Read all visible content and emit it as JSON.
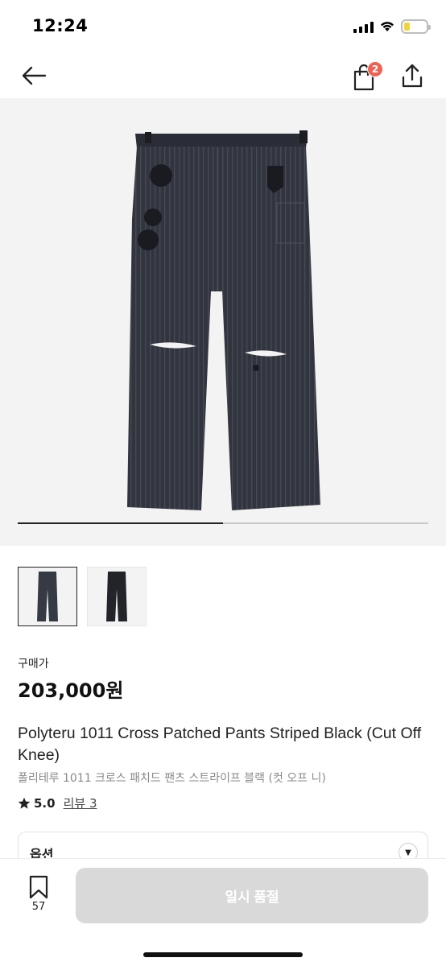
{
  "status_bar": {
    "time": "12:24",
    "icons": [
      "signal-icon",
      "wifi-icon",
      "battery-icon"
    ],
    "battery_level": 0.25,
    "battery_color": "#f2d43a"
  },
  "nav": {
    "back_icon": "arrow-left-icon",
    "cart_icon": "shopping-bag-icon",
    "cart_badge": "2",
    "share_icon": "share-icon",
    "badge_color": "#ef6253"
  },
  "gallery": {
    "image_count": 2,
    "current_index": 1,
    "progress": 0.5
  },
  "price": {
    "label": "구매가",
    "value": "203,000원"
  },
  "product": {
    "title_en": "Polyteru 1011 Cross Patched Pants Striped Black (Cut Off Knee)",
    "title_kr": "폴리테루 1011 크로스 패치드 팬츠 스트라이프 블랙 (컷 오프 니)",
    "rating": "5.0",
    "review_link": "리뷰 3"
  },
  "option": {
    "label": "옵션",
    "toggle_icon": "chevron-down-icon"
  },
  "bottom_bar": {
    "wish_icon": "bookmark-icon",
    "wish_count": "57",
    "action_label": "일시 품절",
    "action_color": "#d9d9d9"
  }
}
